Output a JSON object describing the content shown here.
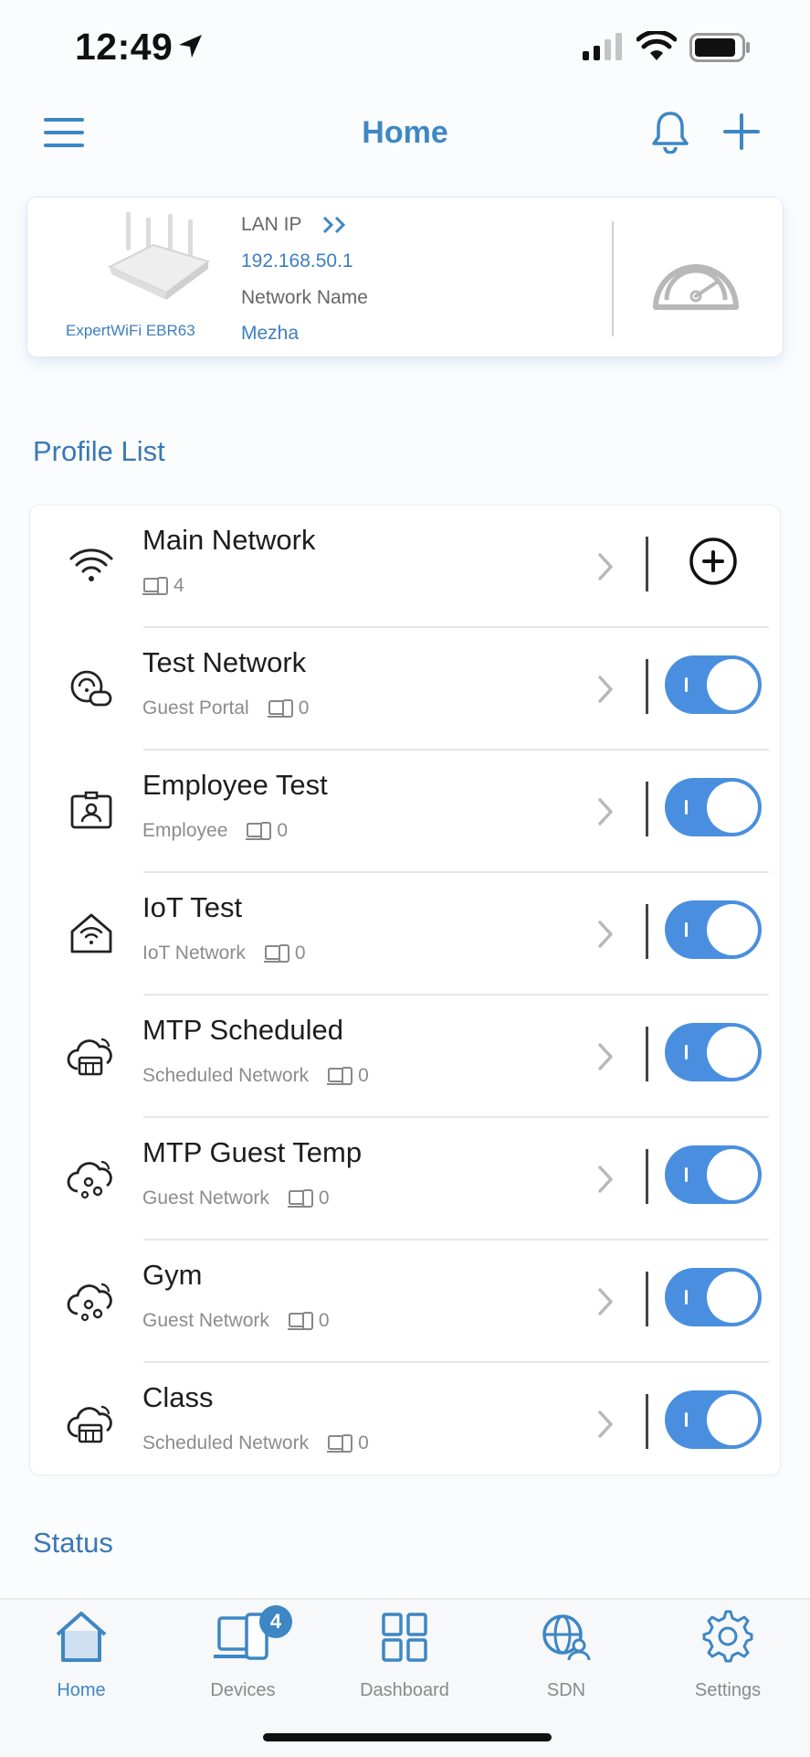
{
  "status_bar": {
    "time": "12:49"
  },
  "nav": {
    "title": "Home"
  },
  "router": {
    "model": "ExpertWiFi EBR63",
    "lan_ip_label": "LAN IP",
    "lan_ip": "192.168.50.1",
    "network_name_label": "Network Name",
    "network_name": "Mezha"
  },
  "profile_list": {
    "title": "Profile List",
    "items": [
      {
        "name": "Main Network",
        "type": "",
        "devices": "4",
        "icon": "wifi-icon",
        "control": "add",
        "enabled": null
      },
      {
        "name": "Test Network",
        "type": "Guest Portal",
        "devices": "0",
        "icon": "guest-portal-icon",
        "control": "toggle",
        "enabled": true
      },
      {
        "name": "Employee Test",
        "type": "Employee",
        "devices": "0",
        "icon": "employee-badge-icon",
        "control": "toggle",
        "enabled": true
      },
      {
        "name": "IoT Test",
        "type": "IoT Network",
        "devices": "0",
        "icon": "iot-home-icon",
        "control": "toggle",
        "enabled": true
      },
      {
        "name": "MTP Scheduled",
        "type": "Scheduled Network",
        "devices": "0",
        "icon": "scheduled-network-icon",
        "control": "toggle",
        "enabled": true
      },
      {
        "name": "MTP Guest Temp",
        "type": "Guest Network",
        "devices": "0",
        "icon": "guest-network-icon",
        "control": "toggle",
        "enabled": true
      },
      {
        "name": "Gym",
        "type": "Guest Network",
        "devices": "0",
        "icon": "guest-network-icon",
        "control": "toggle",
        "enabled": true
      },
      {
        "name": "Class",
        "type": "Scheduled Network",
        "devices": "0",
        "icon": "scheduled-network-icon",
        "control": "toggle",
        "enabled": true
      }
    ]
  },
  "status_section": {
    "title": "Status"
  },
  "tabs": [
    {
      "label": "Home",
      "icon": "home-icon",
      "active": true
    },
    {
      "label": "Devices",
      "icon": "devices-icon",
      "active": false,
      "badge": "4"
    },
    {
      "label": "Dashboard",
      "icon": "dashboard-icon",
      "active": false
    },
    {
      "label": "SDN",
      "icon": "sdn-globe-icon",
      "active": false
    },
    {
      "label": "Settings",
      "icon": "settings-gear-icon",
      "active": false
    }
  ],
  "colors": {
    "accent": "#3d87c4",
    "toggle_on": "#4a8fdf",
    "text_secondary": "#8c8c8c"
  }
}
